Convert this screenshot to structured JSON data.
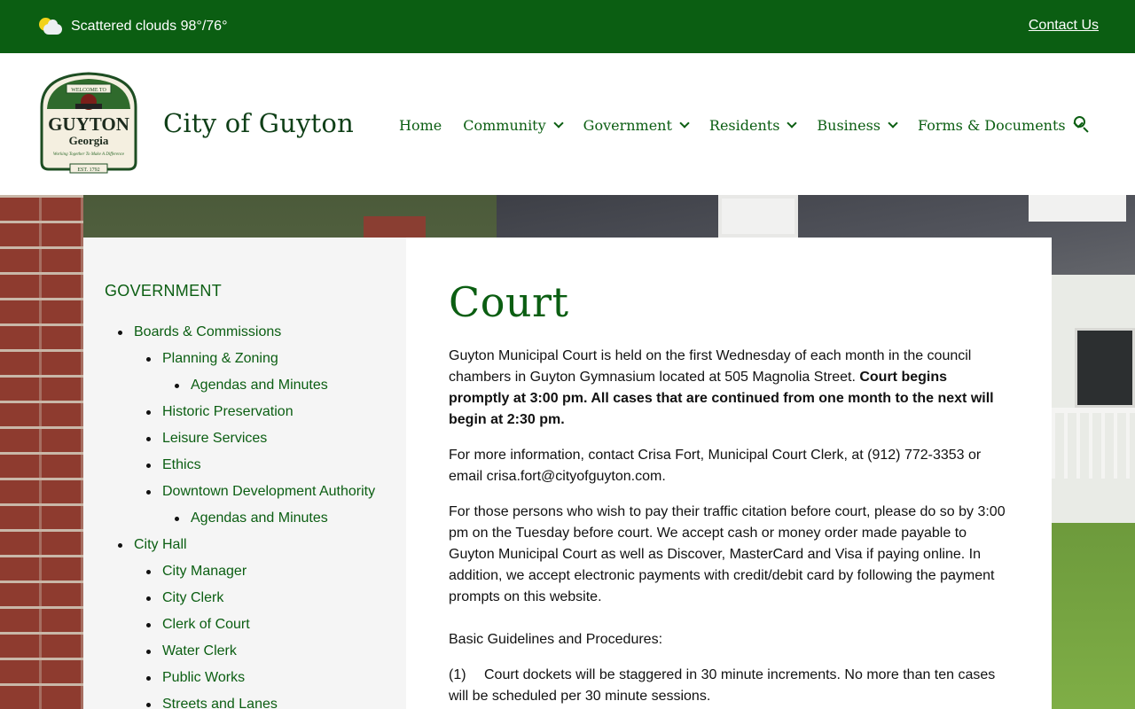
{
  "topbar": {
    "weather_text": "Scattered clouds 98°/76°",
    "contact_label": "Contact Us"
  },
  "header": {
    "site_title": "City of Guyton",
    "logo": {
      "top_banner": "WELCOME TO",
      "name": "GUYTON",
      "state": "Georgia",
      "slogan": "Working Together To Make A Difference",
      "established": "EST. 1792"
    },
    "nav": [
      {
        "label": "Home",
        "has_menu": false
      },
      {
        "label": "Community",
        "has_menu": true
      },
      {
        "label": "Government",
        "has_menu": true
      },
      {
        "label": "Residents",
        "has_menu": true
      },
      {
        "label": "Business",
        "has_menu": true
      },
      {
        "label": "Forms & Documents",
        "has_menu": true
      }
    ]
  },
  "sidebar": {
    "heading": "GOVERNMENT",
    "items": [
      {
        "label": "Boards & Commissions",
        "level": 0
      },
      {
        "label": "Planning & Zoning",
        "level": 1
      },
      {
        "label": "Agendas and Minutes",
        "level": 2
      },
      {
        "label": "Historic Preservation",
        "level": 1
      },
      {
        "label": "Leisure Services",
        "level": 1
      },
      {
        "label": "Ethics",
        "level": 1
      },
      {
        "label": "Downtown Development Authority",
        "level": 1
      },
      {
        "label": "Agendas and Minutes",
        "level": 2
      },
      {
        "label": "City Hall",
        "level": 0
      },
      {
        "label": "City Manager",
        "level": 1
      },
      {
        "label": "City Clerk",
        "level": 1
      },
      {
        "label": "Clerk of Court",
        "level": 1
      },
      {
        "label": "Water Clerk",
        "level": 1
      },
      {
        "label": "Public Works",
        "level": 1
      },
      {
        "label": "Streets and Lanes",
        "level": 1
      }
    ]
  },
  "content": {
    "title": "Court",
    "p1_normal": "Guyton Municipal Court is held on the first Wednesday of each month in the council chambers in Guyton Gymnasium located at 505 Magnolia Street. ",
    "p1_bold": "Court begins promptly at 3:00 pm. All cases that are continued from one month to the next will begin at 2:30 pm.",
    "p2": "For more information, contact Crisa Fort, Municipal Court Clerk, at (912) 772-3353 or email crisa.fort@cityofguyton.com.",
    "p3": "For those persons who wish to pay their traffic citation before court, please do so by 3:00 pm on the Tuesday before court. We accept cash or money order made payable to Guyton Municipal Court as well as Discover, MasterCard and Visa if paying online.  In addition, we accept electronic payments with credit/debit card by following the payment prompts on this website.",
    "guidelines_heading": "Basic Guidelines and Procedures:",
    "rules": [
      {
        "num": "(1)",
        "text": "Court dockets will be staggered in 30 minute increments.  No more than ten cases will be scheduled per 30 minute sessions."
      }
    ]
  }
}
